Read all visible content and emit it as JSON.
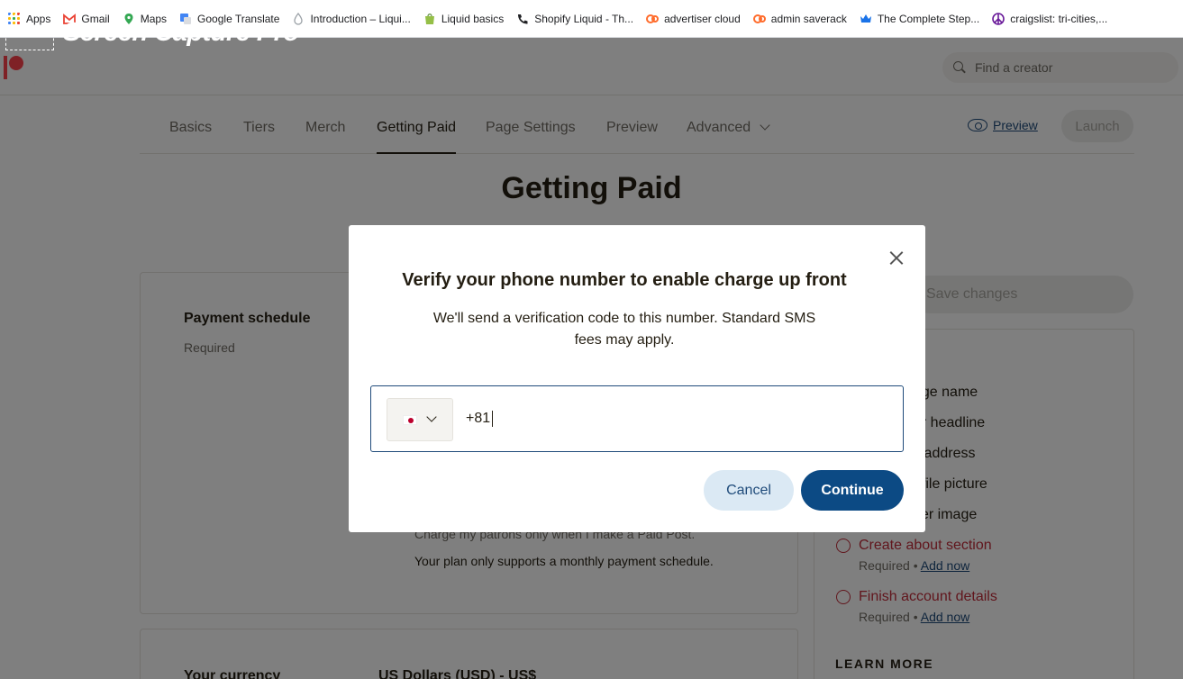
{
  "bookmarks": [
    {
      "label": "Apps",
      "icon": "apps-grid-icon",
      "color": "#4285f4"
    },
    {
      "label": "Gmail",
      "icon": "gmail-icon",
      "color": "#ea4335"
    },
    {
      "label": "Maps",
      "icon": "maps-pin-icon",
      "color": "#34a853"
    },
    {
      "label": "Google Translate",
      "icon": "translate-icon",
      "color": "#4285f4"
    },
    {
      "label": "Introduction – Liqui...",
      "icon": "droplet-icon",
      "color": "#9aa0a6"
    },
    {
      "label": "Liquid basics",
      "icon": "shopify-bag-icon",
      "color": "#95bf47"
    },
    {
      "label": "Shopify Liquid - Th...",
      "icon": "phone-icon",
      "color": "#202124"
    },
    {
      "label": "advertiser cloud",
      "icon": "cpanel-icon",
      "color": "#ff6c2c"
    },
    {
      "label": "admin saverack",
      "icon": "cpanel-icon",
      "color": "#ff6c2c"
    },
    {
      "label": "The Complete Step...",
      "icon": "crown-icon",
      "color": "#1a73e8"
    },
    {
      "label": "craigslist: tri-cities,...",
      "icon": "peace-icon",
      "color": "#6a1b9a"
    }
  ],
  "watermark": "Screen Capture Pro",
  "search": {
    "placeholder": "Find a creator"
  },
  "tabs": [
    {
      "label": "Basics"
    },
    {
      "label": "Tiers"
    },
    {
      "label": "Merch"
    },
    {
      "label": "Getting Paid",
      "active": true
    },
    {
      "label": "Page Settings"
    },
    {
      "label": "Preview"
    },
    {
      "label": "Advanced"
    }
  ],
  "header_actions": {
    "preview": "Preview",
    "launch": "Launch"
  },
  "page": {
    "title": "Getting Paid",
    "save_label": "Save changes",
    "payment_schedule": {
      "title": "Payment schedule",
      "required": "Required",
      "option_text": "Charge my patrons only when I make a Paid Post.",
      "plan_note": "Your plan only supports a monthly payment schedule."
    },
    "currency": {
      "label": "Your currency",
      "value": "US Dollars (USD) - US$"
    }
  },
  "checklist": {
    "partial_items": [
      "age name",
      "ur headline",
      "il address",
      "ofile picture",
      "ver image"
    ],
    "todo": [
      {
        "label": "Create about section",
        "required": "Required",
        "sep": "•",
        "action": "Add now"
      },
      {
        "label": "Finish account details",
        "required": "Required",
        "sep": "•",
        "action": "Add now"
      }
    ],
    "learn_more": "LEARN MORE"
  },
  "modal": {
    "title": "Verify your phone number to enable charge up front",
    "description": "We'll send a verification code to this number. Standard SMS fees may apply.",
    "country_flag": "japan-flag-icon",
    "phone_value": "+81",
    "cancel": "Cancel",
    "continue": "Continue"
  },
  "colors": {
    "brand": "#ff424d",
    "primary": "#0c4a84",
    "link": "#1f4b7a",
    "error": "#c22c3a"
  }
}
